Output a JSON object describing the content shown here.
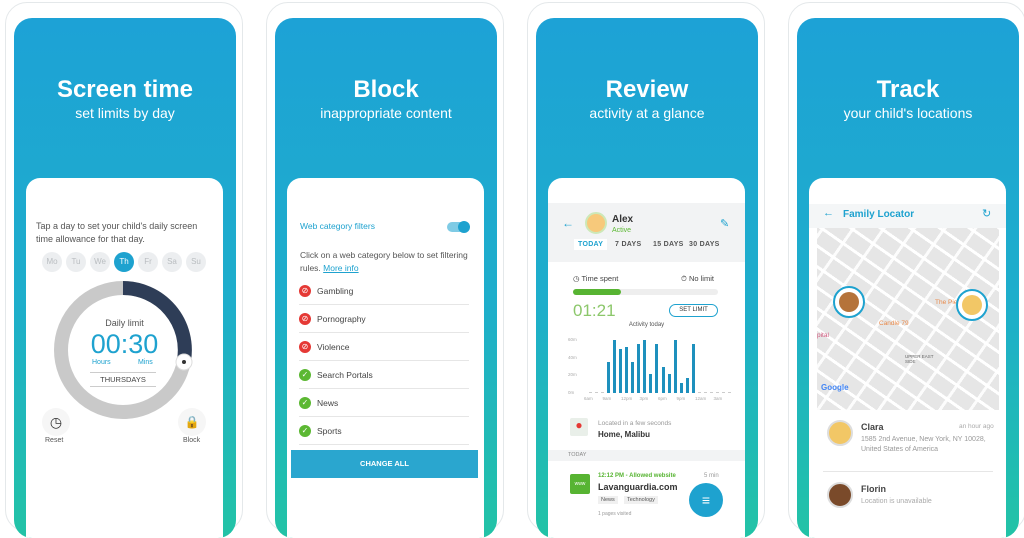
{
  "panels": [
    {
      "title": "Screen time",
      "subtitle": "set limits by day"
    },
    {
      "title": "Block",
      "subtitle": "inappropriate content"
    },
    {
      "title": "Review",
      "subtitle": "activity at a glance"
    },
    {
      "title": "Track",
      "subtitle": "your child's locations"
    }
  ],
  "screen_time": {
    "instruction": "Tap a day to set your child's daily screen time allowance for that day.",
    "days": [
      "Mo",
      "Tu",
      "We",
      "Th",
      "Fr",
      "Sa",
      "Su"
    ],
    "selected_day": "Th",
    "dial_label": "Daily limit",
    "time": "00:30",
    "hours_label": "Hours",
    "mins_label": "Mins",
    "day_name": "THURSDAYS",
    "reset_label": "Reset",
    "block_label": "Block"
  },
  "block": {
    "filter_title": "Web category filters",
    "filter_enabled": true,
    "description": "Click on a web category below to set filtering rules.",
    "more_info": "More info",
    "categories": [
      {
        "label": "Gambling",
        "status": "blocked"
      },
      {
        "label": "Pornography",
        "status": "blocked"
      },
      {
        "label": "Violence",
        "status": "blocked"
      },
      {
        "label": "Search Portals",
        "status": "allowed"
      },
      {
        "label": "News",
        "status": "allowed"
      },
      {
        "label": "Sports",
        "status": "allowed"
      }
    ],
    "change_all": "CHANGE ALL"
  },
  "review": {
    "name": "Alex",
    "status": "Active",
    "tabs": [
      "TODAY",
      "7 DAYS",
      "15 DAYS",
      "30 DAYS"
    ],
    "time_spent_label": "Time spent",
    "limit_label": "No limit",
    "progress": 0.33,
    "time_spent": "01:21",
    "set_limit": "SET LIMIT",
    "chart_title": "Activity today",
    "location_caption": "Located in a few seconds",
    "location": "Home, Malibu",
    "section": "TODAY",
    "activity": {
      "time": "12:12 PM - Allowed website",
      "site": "Lavanguardia.com",
      "duration": "5 min",
      "tags": [
        "News",
        "Technology"
      ],
      "pages": "1 pages visited",
      "icon_text": "www"
    }
  },
  "chart_data": {
    "type": "bar",
    "title": "Activity today",
    "yticks": [
      "60m",
      "40m",
      "20m",
      "0m"
    ],
    "ylim": [
      0,
      60
    ],
    "xticks": [
      "6am",
      "9am",
      "12pm",
      "3pm",
      "6pm",
      "9pm",
      "12am",
      "3am"
    ],
    "values": [
      0,
      0,
      0,
      35,
      60,
      50,
      52,
      35,
      56,
      60,
      21,
      56,
      29,
      21,
      60,
      11,
      17,
      55,
      0,
      0,
      0,
      0,
      0,
      0
    ]
  },
  "track": {
    "title": "Family Locator",
    "map_labels": [
      "Candle 79",
      "The Pie",
      "UPPER EAST SIDE",
      "pital"
    ],
    "map_brand": "Google",
    "people": [
      {
        "name": "Clara",
        "time": "an hour ago",
        "detail": "1585 2nd Avenue, New York, NY 10028, United States of America"
      },
      {
        "name": "Florin",
        "time": "",
        "detail": "Location is unavailable"
      }
    ]
  },
  "colors": {
    "teal": "#1ea2cf",
    "green": "#5cb833",
    "red": "#e53935",
    "dark": "#2e3d57"
  }
}
